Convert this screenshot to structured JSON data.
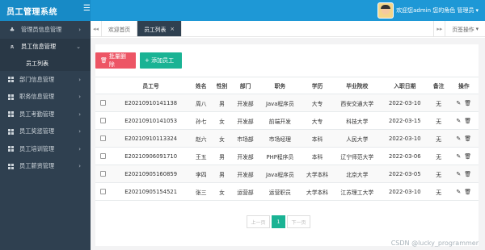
{
  "app": {
    "title": "员工管理系统",
    "menu_icon": "hamburger-icon"
  },
  "user": {
    "greeting": "欢迎您admin 您的角色 管理员",
    "dropdown_icon": "caret-down-icon"
  },
  "sidebar": {
    "items": [
      {
        "label": "管理员信息管理",
        "icon": "users-icon"
      },
      {
        "label": "员工信息管理",
        "icon": "user-icon",
        "active": true
      },
      {
        "label": "部门信息管理",
        "icon": "grid-icon"
      },
      {
        "label": "职务信息管理",
        "icon": "grid-icon"
      },
      {
        "label": "员工考勤管理",
        "icon": "grid-icon"
      },
      {
        "label": "员工奖惩管理",
        "icon": "grid-icon"
      },
      {
        "label": "员工培训管理",
        "icon": "grid-icon"
      },
      {
        "label": "员工薪资管理",
        "icon": "grid-icon"
      }
    ],
    "sub_item": "员工列表"
  },
  "tabs": {
    "items": [
      {
        "label": "欢迎首页"
      },
      {
        "label": "员工列表",
        "active": true
      }
    ],
    "ops_label": "页签操作"
  },
  "toolbar": {
    "delete_label": "批量删除",
    "add_label": "+ 添加员工"
  },
  "table": {
    "headers": [
      "",
      "员工号",
      "姓名",
      "性别",
      "部门",
      "职务",
      "学历",
      "毕业院校",
      "入职日期",
      "备注",
      "操作"
    ],
    "rows": [
      {
        "id": "E20210910141138",
        "name": "周八",
        "gender": "男",
        "dept": "开发部",
        "job": "Java程序员",
        "edu": "大专",
        "school": "西安交通大学",
        "date": "2022-03-10",
        "note": "无"
      },
      {
        "id": "E20210910141053",
        "name": "孙七",
        "gender": "女",
        "dept": "开发部",
        "job": "前端开发",
        "edu": "大专",
        "school": "科技大学",
        "date": "2022-03-15",
        "note": "无"
      },
      {
        "id": "E20210910113324",
        "name": "赵六",
        "gender": "女",
        "dept": "市场部",
        "job": "市场经理",
        "edu": "本科",
        "school": "人民大学",
        "date": "2022-03-10",
        "note": "无"
      },
      {
        "id": "E20210906091710",
        "name": "王五",
        "gender": "男",
        "dept": "开发部",
        "job": "PHP程序员",
        "edu": "本科",
        "school": "辽宁师范大学",
        "date": "2022-03-06",
        "note": "无"
      },
      {
        "id": "E20210905160859",
        "name": "李四",
        "gender": "男",
        "dept": "开发部",
        "job": "Java程序员",
        "edu": "大学本科",
        "school": "北京大学",
        "date": "2022-03-05",
        "note": "无"
      },
      {
        "id": "E20210905154521",
        "name": "张三",
        "gender": "女",
        "dept": "运营部",
        "job": "运营职员",
        "edu": "大学本科",
        "school": "江苏理工大学",
        "date": "2022-03-10",
        "note": "无"
      }
    ]
  },
  "pagination": {
    "prev": "上一页",
    "current": "1",
    "next": "下一页"
  },
  "watermark": "CSDN @lucky_programmer",
  "colors": {
    "topbar": "#1e98d6",
    "sidebar": "#2f4050",
    "danger": "#ed5565",
    "primary": "#1ab394"
  }
}
